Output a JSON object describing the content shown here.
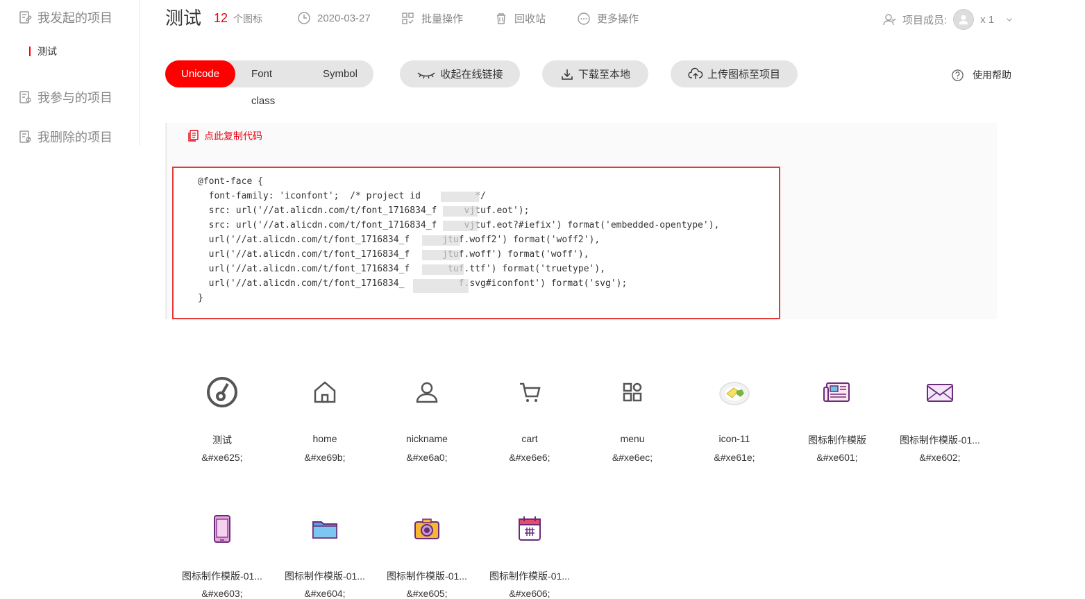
{
  "sidebar": {
    "items": [
      {
        "label": "我发起的项目",
        "icon": "project-doc-icon"
      },
      {
        "label": "我参与的项目",
        "icon": "project-doc-icon"
      },
      {
        "label": "我删除的项目",
        "icon": "project-doc-icon"
      }
    ],
    "sub_item": {
      "label": "测试"
    }
  },
  "header": {
    "title": "测试",
    "icon_count": "12",
    "icon_count_unit": "个图标",
    "date": "2020-03-27",
    "batch_label": "批量操作",
    "recycle_label": "回收站",
    "more_label": "更多操作",
    "members_label": "项目成员:",
    "members_count": "x 1"
  },
  "toolbar": {
    "tabs": [
      {
        "label": "Unicode",
        "active": true
      },
      {
        "label": "Font class",
        "active": false
      },
      {
        "label": "Symbol",
        "active": false
      }
    ],
    "collapse_label": "收起在线链接",
    "download_label": "下载至本地",
    "upload_label": "上传图标至项目",
    "help_label": "使用帮助"
  },
  "code": {
    "copy_label": "点此复制代码",
    "lines": [
      "@font-face {",
      "  font-family: 'iconfont';  /* project id          */",
      "  src: url('//at.alicdn.com/t/font_1716834_f     vjtuf.eot');",
      "  src: url('//at.alicdn.com/t/font_1716834_f     vjtuf.eot?#iefix') format('embedded-opentype'),",
      "  url('//at.alicdn.com/t/font_1716834_f      jtuf.woff2') format('woff2'),",
      "  url('//at.alicdn.com/t/font_1716834_f      jtuf.woff') format('woff'),",
      "  url('//at.alicdn.com/t/font_1716834_f       tuf.ttf') format('truetype'),",
      "  url('//at.alicdn.com/t/font_1716834_          f.svg#iconfont') format('svg');",
      "}"
    ]
  },
  "icons": [
    {
      "name": "测试",
      "code": "&#xe625;",
      "icon": "speedometer-icon"
    },
    {
      "name": "home",
      "code": "&#xe69b;",
      "icon": "home-icon"
    },
    {
      "name": "nickname",
      "code": "&#xe6a0;",
      "icon": "user-icon"
    },
    {
      "name": "cart",
      "code": "&#xe6e6;",
      "icon": "cart-icon"
    },
    {
      "name": "menu",
      "code": "&#xe6ec;",
      "icon": "menu-grid-icon"
    },
    {
      "name": "icon-11",
      "code": "&#xe61e;",
      "icon": "food-plate-icon"
    },
    {
      "name": "图标制作模版",
      "code": "&#xe601;",
      "icon": "newspaper-icon"
    },
    {
      "name": "图标制作模版-01...",
      "code": "&#xe602;",
      "icon": "envelope-icon"
    },
    {
      "name": "图标制作模版-01...",
      "code": "&#xe603;",
      "icon": "phone-icon"
    },
    {
      "name": "图标制作模版-01...",
      "code": "&#xe604;",
      "icon": "folder-icon"
    },
    {
      "name": "图标制作模版-01...",
      "code": "&#xe605;",
      "icon": "camera-icon"
    },
    {
      "name": "图标制作模版-01...",
      "code": "&#xe606;",
      "icon": "calendar-icon"
    }
  ],
  "colors": {
    "accent": "#e60012",
    "pill_bg": "#e5e5e5",
    "code_border": "#e53935"
  }
}
